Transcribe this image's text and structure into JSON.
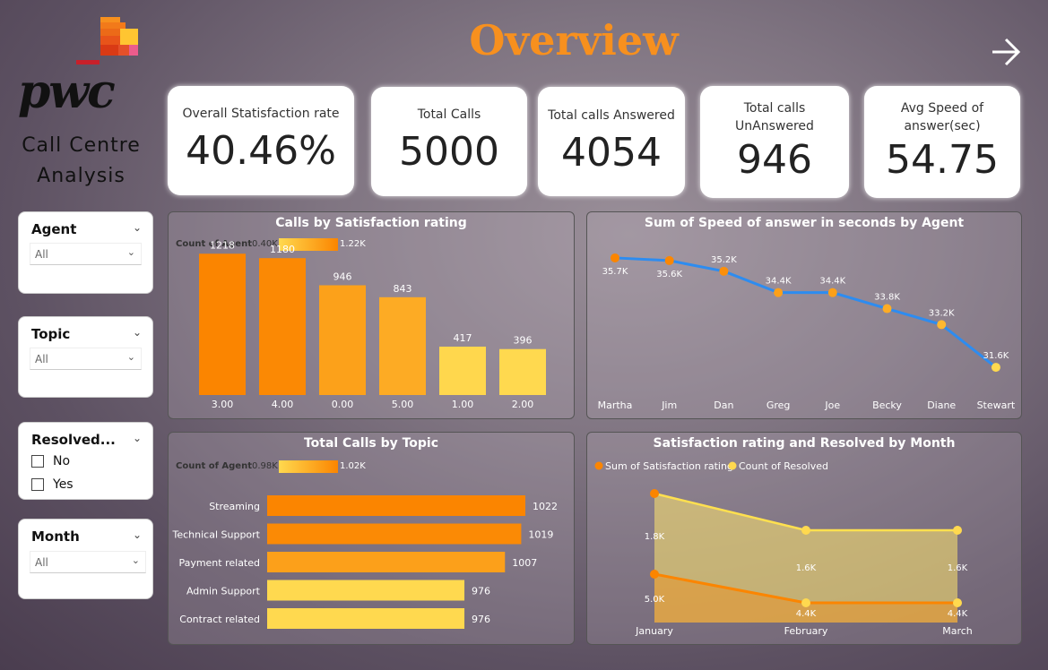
{
  "header": {
    "brand": "pwc",
    "subtitle_line1": "Call Centre",
    "subtitle_line2": "Analysis",
    "title": "Overview"
  },
  "kpis": [
    {
      "label": "Overall Statisfaction rate",
      "value": "40.46%"
    },
    {
      "label": "Total Calls",
      "value": "5000"
    },
    {
      "label": "Total calls Answered",
      "value": "4054"
    },
    {
      "label": "Total calls UnAnswered",
      "value": "946"
    },
    {
      "label": "Avg Speed of answer(sec)",
      "value": "54.75"
    }
  ],
  "slicers": {
    "agent": {
      "label": "Agent",
      "value": "All"
    },
    "topic": {
      "label": "Topic",
      "value": "All"
    },
    "resolved": {
      "label": "Resolved...",
      "options": [
        "No",
        "Yes"
      ]
    },
    "month": {
      "label": "Month",
      "value": "All"
    }
  },
  "colors": {
    "orange_dark": "#fb8500",
    "orange_mid": "#fca32a",
    "yellow": "#ffd94f",
    "line_blue": "#2d8cf0",
    "title_orange": "#f7901e"
  },
  "chart_data": [
    {
      "type": "bar",
      "title": "Calls by Satisfaction rating",
      "legend": {
        "label": "Count of Agent",
        "min": "0.40K",
        "max": "1.22K"
      },
      "categories": [
        "3.00",
        "4.00",
        "0.00",
        "5.00",
        "1.00",
        "2.00"
      ],
      "values": [
        1218,
        1180,
        946,
        843,
        417,
        396
      ],
      "ylim": [
        0,
        1300
      ]
    },
    {
      "type": "line",
      "title": "Sum of Speed of answer in seconds by Agent",
      "categories": [
        "Martha",
        "Jim",
        "Dan",
        "Greg",
        "Joe",
        "Becky",
        "Diane",
        "Stewart"
      ],
      "values": [
        35.7,
        35.6,
        35.2,
        34.4,
        34.4,
        33.8,
        33.2,
        31.6
      ],
      "labels": [
        "35.7K",
        "35.6K",
        "35.2K",
        "34.4K",
        "34.4K",
        "33.8K",
        "33.2K",
        "31.6K"
      ],
      "unit": "K",
      "ylim": [
        31.2,
        36.0
      ]
    },
    {
      "type": "bar",
      "orientation": "horizontal",
      "title": "Total Calls by Topic",
      "legend": {
        "label": "Count of Agent",
        "min": "0.98K",
        "max": "1.02K"
      },
      "categories": [
        "Streaming",
        "Technical Support",
        "Payment related",
        "Admin Support",
        "Contract related"
      ],
      "values": [
        1022,
        1019,
        1007,
        976,
        976
      ],
      "xlim": [
        0,
        1022
      ]
    },
    {
      "type": "area",
      "title": "Satisfaction rating and Resolved by Month",
      "categories": [
        "January",
        "February",
        "March"
      ],
      "series": [
        {
          "name": "Sum of Satisfaction rating",
          "values": [
            5.0,
            4.4,
            4.4
          ],
          "labels": [
            "5.0K",
            "4.4K",
            "4.4K"
          ]
        },
        {
          "name": "Count of Resolved",
          "values": [
            1.8,
            1.6,
            1.6
          ],
          "labels": [
            "1.8K",
            "1.6K",
            "1.6K"
          ]
        }
      ],
      "legend_position": "top-left"
    }
  ]
}
